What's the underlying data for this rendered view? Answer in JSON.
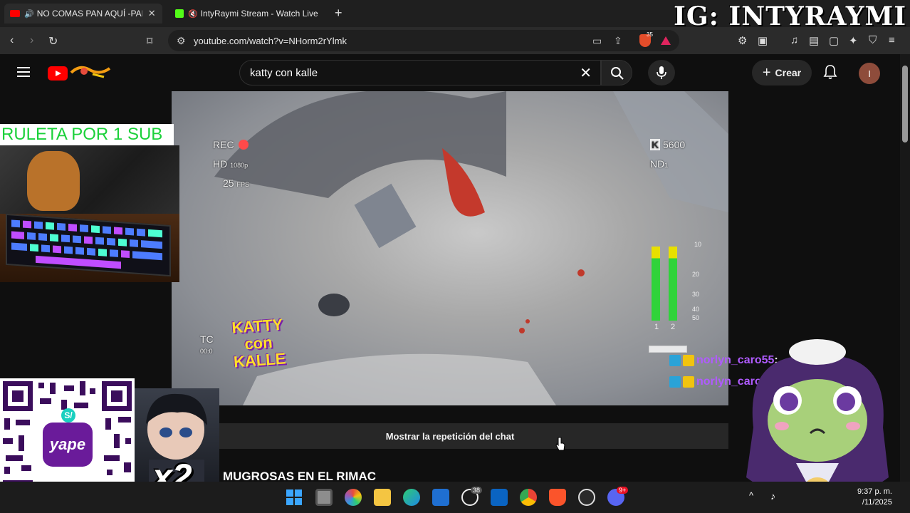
{
  "browser": {
    "tabs": [
      {
        "title": "NO COMAS PAN AQUÍ -PANA",
        "favicon": "youtube-icon",
        "audio": true,
        "active": true
      },
      {
        "title": "IntyRaymi Stream - Watch Live on",
        "favicon": "kick-icon",
        "audio": false,
        "active": false
      }
    ],
    "new_tab_label": "+",
    "url": "youtube.com/watch?v=NHorm2rYlmk",
    "brave_badge": "35"
  },
  "overlay_watermark": "IG: INTYRAYMI",
  "youtube": {
    "search_query": "katty con kalle",
    "create_label": "Crear",
    "avatar_letter": "I",
    "show_chat_replay": "Mostrar la repetición del chat",
    "video_title_partial": "UI - ANDERÍAS MUGROSAS EN EL RIMAC"
  },
  "video_hud": {
    "rec": "REC",
    "hd": "HD",
    "hd_sub": "1080p",
    "fps": "25",
    "fps_sub": "FPS",
    "k_value": "5600",
    "nd": "ND",
    "nd_sub": "1",
    "tc": "TC",
    "tc_value": "00:0",
    "meter_labels": [
      "10",
      "20",
      "30",
      "40",
      "50"
    ],
    "channel_labels": [
      "1",
      "2"
    ],
    "brand_badge": "KATTY con KALLE"
  },
  "stream_overlays": {
    "ruleta": "RULETA POR 1 SUB",
    "yape": "yape",
    "yape_mark": "S/",
    "multiplier": "x2",
    "chat": [
      {
        "user": "norlyn_caro55",
        "suffix": " :"
      },
      {
        "user": "norlyn_caro"
      }
    ]
  },
  "taskbar": {
    "whatsapp_badge": "38",
    "discord_badge": "9+",
    "time": "9:37 p. m.",
    "date": "/11/2025"
  },
  "colors": {
    "youtube_red": "#ff0000",
    "chat_purple": "#b05bff",
    "ruleta_green": "#1bd13a",
    "brave_orange": "#e34d2a"
  }
}
